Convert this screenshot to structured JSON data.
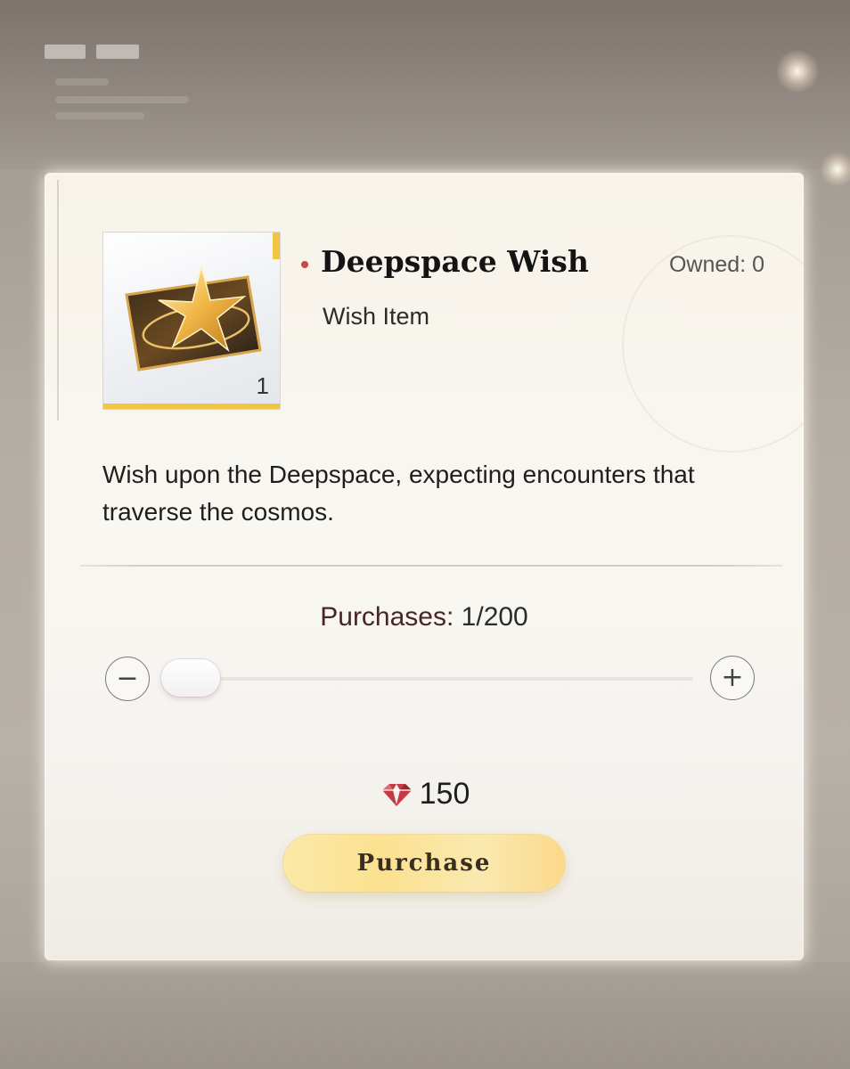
{
  "item": {
    "name": "Deepspace Wish",
    "type": "Wish Item",
    "owned_text": "Owned: 0",
    "quantity_badge": "1",
    "description": "Wish upon the Deepspace, expecting encounters that traverse the cosmos."
  },
  "purchase": {
    "label": "Purchases:",
    "count_text": "1/200",
    "current": 1,
    "max": 200,
    "minus_symbol": "−",
    "plus_symbol": "+",
    "price": "150",
    "currency_icon": "gem-icon",
    "button_label": "Purchase"
  },
  "colors": {
    "accent_gold": "#f2c443",
    "title_dot": "#c84a45",
    "currency_red": "#c63a46",
    "button_gold": "#fbe190"
  }
}
